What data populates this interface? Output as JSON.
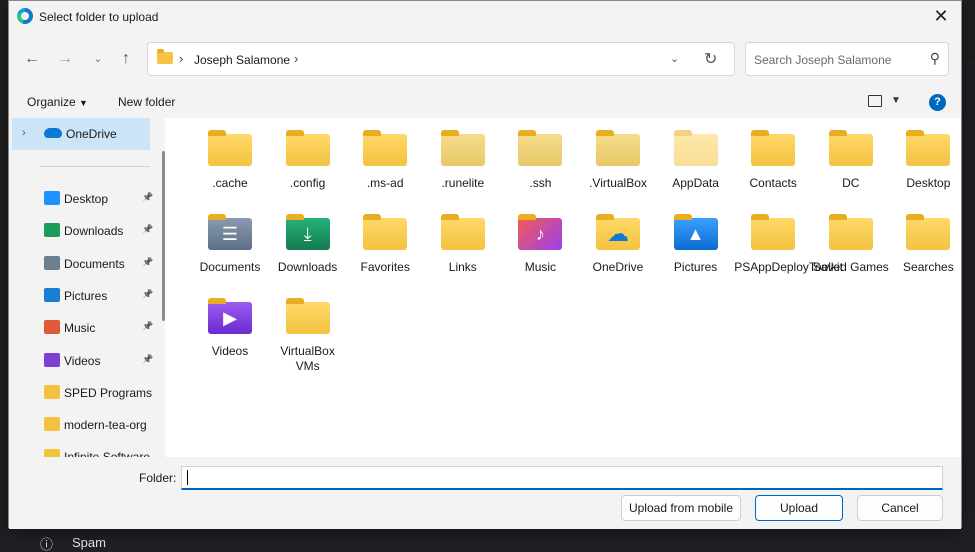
{
  "dialog": {
    "title": "Select folder to upload",
    "address": {
      "crumb": "Joseph Salamone"
    },
    "search_placeholder": "Search Joseph Salamone",
    "toolbar": {
      "organize": "Organize",
      "new_folder": "New folder"
    }
  },
  "sidebar": {
    "onedrive": "OneDrive",
    "items": [
      {
        "label": "Desktop",
        "icon": "desktop-icon",
        "color": "#1e90ff"
      },
      {
        "label": "Downloads",
        "icon": "download-icon",
        "color": "#1a9c5a"
      },
      {
        "label": "Documents",
        "icon": "document-icon",
        "color": "#6e7f92"
      },
      {
        "label": "Pictures",
        "icon": "picture-icon",
        "color": "#1a7fd4"
      },
      {
        "label": "Music",
        "icon": "music-icon",
        "color": "#e05a3a"
      },
      {
        "label": "Videos",
        "icon": "video-icon",
        "color": "#7b3fd1"
      },
      {
        "label": "SPED Programs",
        "icon": "folder-icon",
        "color": "#f3c340"
      },
      {
        "label": "modern-tea-org",
        "icon": "folder-icon",
        "color": "#f3c340"
      },
      {
        "label": "Infinite Software",
        "icon": "folder-icon",
        "color": "#f3c340"
      }
    ]
  },
  "folders": [
    {
      "label": ".cache",
      "icon": "folder-icon"
    },
    {
      "label": ".config",
      "icon": "folder-icon"
    },
    {
      "label": ".ms-ad",
      "icon": "folder-icon"
    },
    {
      "label": ".runelite",
      "icon": "folder-icon"
    },
    {
      "label": ".ssh",
      "icon": "folder-icon"
    },
    {
      "label": ".VirtualBox",
      "icon": "folder-icon"
    },
    {
      "label": "AppData",
      "icon": "folder-icon"
    },
    {
      "label": "Contacts",
      "icon": "folder-icon"
    },
    {
      "label": "DC",
      "icon": "folder-icon"
    },
    {
      "label": "Desktop",
      "icon": "folder-icon"
    },
    {
      "label": "Documents",
      "icon": "documents-folder-icon"
    },
    {
      "label": "Downloads",
      "icon": "downloads-folder-icon"
    },
    {
      "label": "Favorites",
      "icon": "folder-icon"
    },
    {
      "label": "Links",
      "icon": "folder-icon"
    },
    {
      "label": "Music",
      "icon": "music-folder-icon"
    },
    {
      "label": "OneDrive",
      "icon": "onedrive-folder-icon"
    },
    {
      "label": "Pictures",
      "icon": "pictures-folder-icon"
    },
    {
      "label": "PSAppDeployToolkit",
      "icon": "folder-icon"
    },
    {
      "label": "Saved Games",
      "icon": "folder-icon"
    },
    {
      "label": "Searches",
      "icon": "folder-icon"
    },
    {
      "label": "Videos",
      "icon": "videos-folder-icon"
    },
    {
      "label": "VirtualBox VMs",
      "icon": "folder-icon"
    }
  ],
  "footer": {
    "folder_label": "Folder:",
    "folder_value": "",
    "upload_mobile": "Upload from mobile",
    "upload": "Upload",
    "cancel": "Cancel"
  },
  "background": {
    "spam": "Spam"
  },
  "colors": {
    "accent": "#0067c0",
    "folder": "#f3c340",
    "selection": "#cce4f7"
  }
}
